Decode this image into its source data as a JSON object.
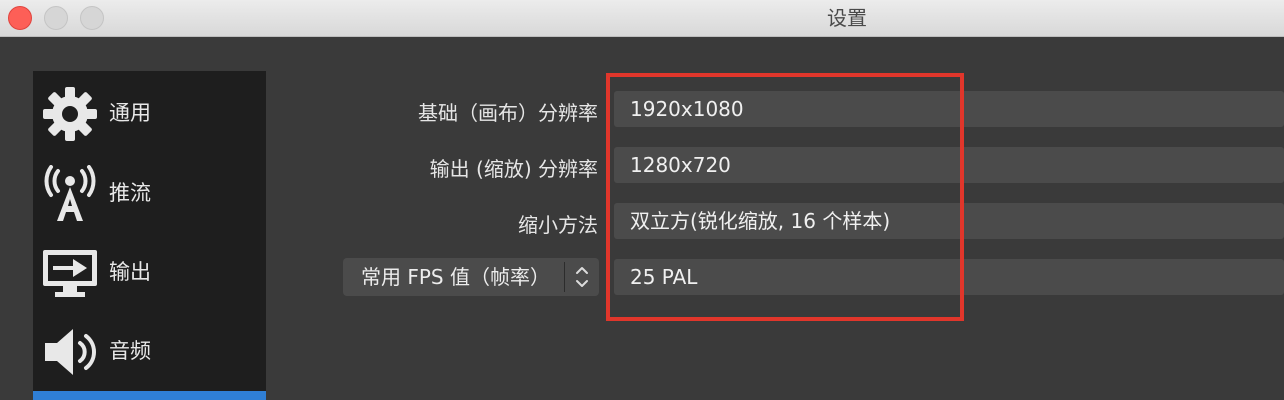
{
  "window": {
    "title": "设置"
  },
  "sidebar": {
    "items": [
      {
        "label": "通用",
        "icon": "gear-icon"
      },
      {
        "label": "推流",
        "icon": "broadcast-antenna-icon"
      },
      {
        "label": "输出",
        "icon": "monitor-output-icon"
      },
      {
        "label": "音频",
        "icon": "speaker-icon"
      }
    ]
  },
  "video": {
    "base_resolution_label": "基础（画布）分辨率",
    "base_resolution_value": "1920x1080",
    "output_resolution_label": "输出 (缩放) 分辨率",
    "output_resolution_value": "1280x720",
    "downscale_filter_label": "缩小方法",
    "downscale_filter_value": "双立方(锐化缩放, 16 个样本)",
    "fps_type_selected": "常用 FPS 值（帧率）",
    "fps_value": "25 PAL"
  },
  "colors": {
    "highlight_border": "#e0362b",
    "sidebar_selected": "#2f7fd6",
    "close_button": "#fd5f57"
  }
}
